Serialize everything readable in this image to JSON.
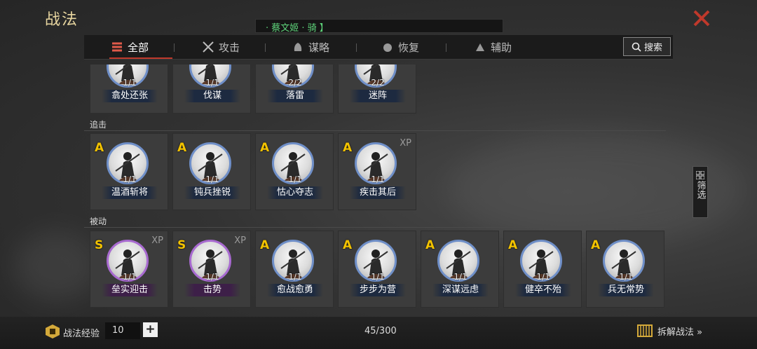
{
  "header": {
    "title": "战法",
    "hero_text": "· 蔡文姬 · 骑 】"
  },
  "tabs": [
    {
      "label": "全部",
      "icon": "all-icon",
      "active": true
    },
    {
      "label": "攻击",
      "icon": "crossed-swords-icon",
      "active": false
    },
    {
      "label": "谋略",
      "icon": "strategy-icon",
      "active": false
    },
    {
      "label": "恢复",
      "icon": "recover-icon",
      "active": false
    },
    {
      "label": "辅助",
      "icon": "assist-icon",
      "active": false
    }
  ],
  "search": {
    "label": "搜索"
  },
  "sections": [
    {
      "label": "",
      "cards": [
        {
          "name": "翕处还张",
          "count": "1/1",
          "grade": "",
          "xp": ""
        },
        {
          "name": "伐谋",
          "count": "1/1",
          "grade": "",
          "xp": ""
        },
        {
          "name": "落雷",
          "count": "2/2",
          "grade": "",
          "xp": ""
        },
        {
          "name": "迷阵",
          "count": "2/2",
          "grade": "",
          "xp": ""
        }
      ]
    },
    {
      "label": "追击",
      "cards": [
        {
          "name": "温酒斩将",
          "count": "1/1",
          "grade": "A",
          "xp": ""
        },
        {
          "name": "钝兵挫锐",
          "count": "1/1",
          "grade": "A",
          "xp": ""
        },
        {
          "name": "怙心夺志",
          "count": "1/1",
          "grade": "A",
          "xp": ""
        },
        {
          "name": "疾击其后",
          "count": "1/1",
          "grade": "A",
          "xp": "XP"
        }
      ]
    },
    {
      "label": "被动",
      "cards": [
        {
          "name": "垒实迎击",
          "count": "1/1",
          "grade": "S",
          "xp": "XP"
        },
        {
          "name": "击势",
          "count": "1/1",
          "grade": "S",
          "xp": "XP"
        },
        {
          "name": "愈战愈勇",
          "count": "1/1",
          "grade": "A",
          "xp": ""
        },
        {
          "name": "步步为营",
          "count": "1/1",
          "grade": "A",
          "xp": ""
        },
        {
          "name": "深谋远虑",
          "count": "1/1",
          "grade": "A",
          "xp": ""
        },
        {
          "name": "健卒不殆",
          "count": "1/1",
          "grade": "A",
          "xp": ""
        },
        {
          "name": "兵无常势",
          "count": "1/1",
          "grade": "A",
          "xp": ""
        }
      ]
    }
  ],
  "filter": {
    "label": "筛选"
  },
  "footer": {
    "exp_label": "战法经验",
    "exp_value": "10",
    "plus": "+",
    "capacity": "45/300",
    "dismantle_label": "拆解战法 »"
  },
  "colors": {
    "accent_red": "#c0392b",
    "title_gold": "#e8d6a0",
    "hero_green": "#5ed37a",
    "grade_gold": "#f2c200",
    "s_border": "#a86ad0",
    "a_border": "#6f8fc8"
  }
}
